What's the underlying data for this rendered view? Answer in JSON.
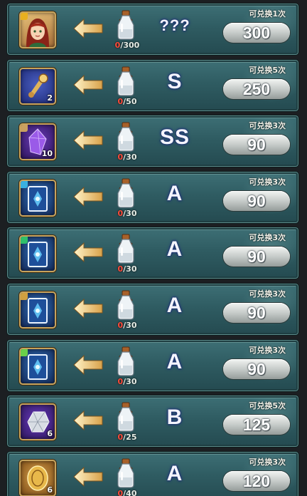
{
  "rows": [
    {
      "item": "hero-portrait",
      "slot_class": "portrait",
      "quantity": "",
      "grade": "???",
      "collected": "0",
      "required": "/300",
      "limit": "可兑换1次",
      "price": "300",
      "badge_color": "#e8b020"
    },
    {
      "item": "key-scroll",
      "slot_class": "item-key",
      "quantity": "2",
      "grade": "S",
      "collected": "0",
      "required": "/50",
      "limit": "可兑换5次",
      "price": "250",
      "badge_color": ""
    },
    {
      "item": "purple-crystal",
      "slot_class": "item-gem",
      "quantity": "10",
      "grade": "SS",
      "collected": "0",
      "required": "/30",
      "limit": "可兑换3次",
      "price": "90",
      "badge_color": "#c8a060"
    },
    {
      "item": "blue-card",
      "slot_class": "item-card",
      "quantity": "",
      "grade": "A",
      "collected": "0",
      "required": "/30",
      "limit": "可兑换3次",
      "price": "90",
      "badge_color": "#3ab0e0"
    },
    {
      "item": "blue-card",
      "slot_class": "item-card",
      "quantity": "",
      "grade": "A",
      "collected": "0",
      "required": "/30",
      "limit": "可兑换3次",
      "price": "90",
      "badge_color": "#2fbf6a"
    },
    {
      "item": "blue-card",
      "slot_class": "item-card",
      "quantity": "",
      "grade": "A",
      "collected": "0",
      "required": "/30",
      "limit": "可兑换3次",
      "price": "90",
      "badge_color": "#d0a040"
    },
    {
      "item": "blue-card",
      "slot_class": "item-card",
      "quantity": "",
      "grade": "A",
      "collected": "0",
      "required": "/30",
      "limit": "可兑换3次",
      "price": "90",
      "badge_color": "#6ad04a"
    },
    {
      "item": "silver-stone",
      "slot_class": "item-stone",
      "quantity": "6",
      "grade": "B",
      "collected": "0",
      "required": "/25",
      "limit": "可兑换5次",
      "price": "125",
      "badge_color": ""
    },
    {
      "item": "gold-coin",
      "slot_class": "item-coin",
      "quantity": "6",
      "grade": "A",
      "collected": "0",
      "required": "/40",
      "limit": "可兑换3次",
      "price": "120",
      "badge_color": ""
    }
  ],
  "icons": {
    "arrow": "left-arrow-icon",
    "bottle": "potion-bottle-icon"
  },
  "colors": {
    "row_bg": "#2f5c62",
    "count_current": "#ff4b3a",
    "grade_text": "#f4f4ff",
    "frame_gold": "#c7a35c"
  }
}
